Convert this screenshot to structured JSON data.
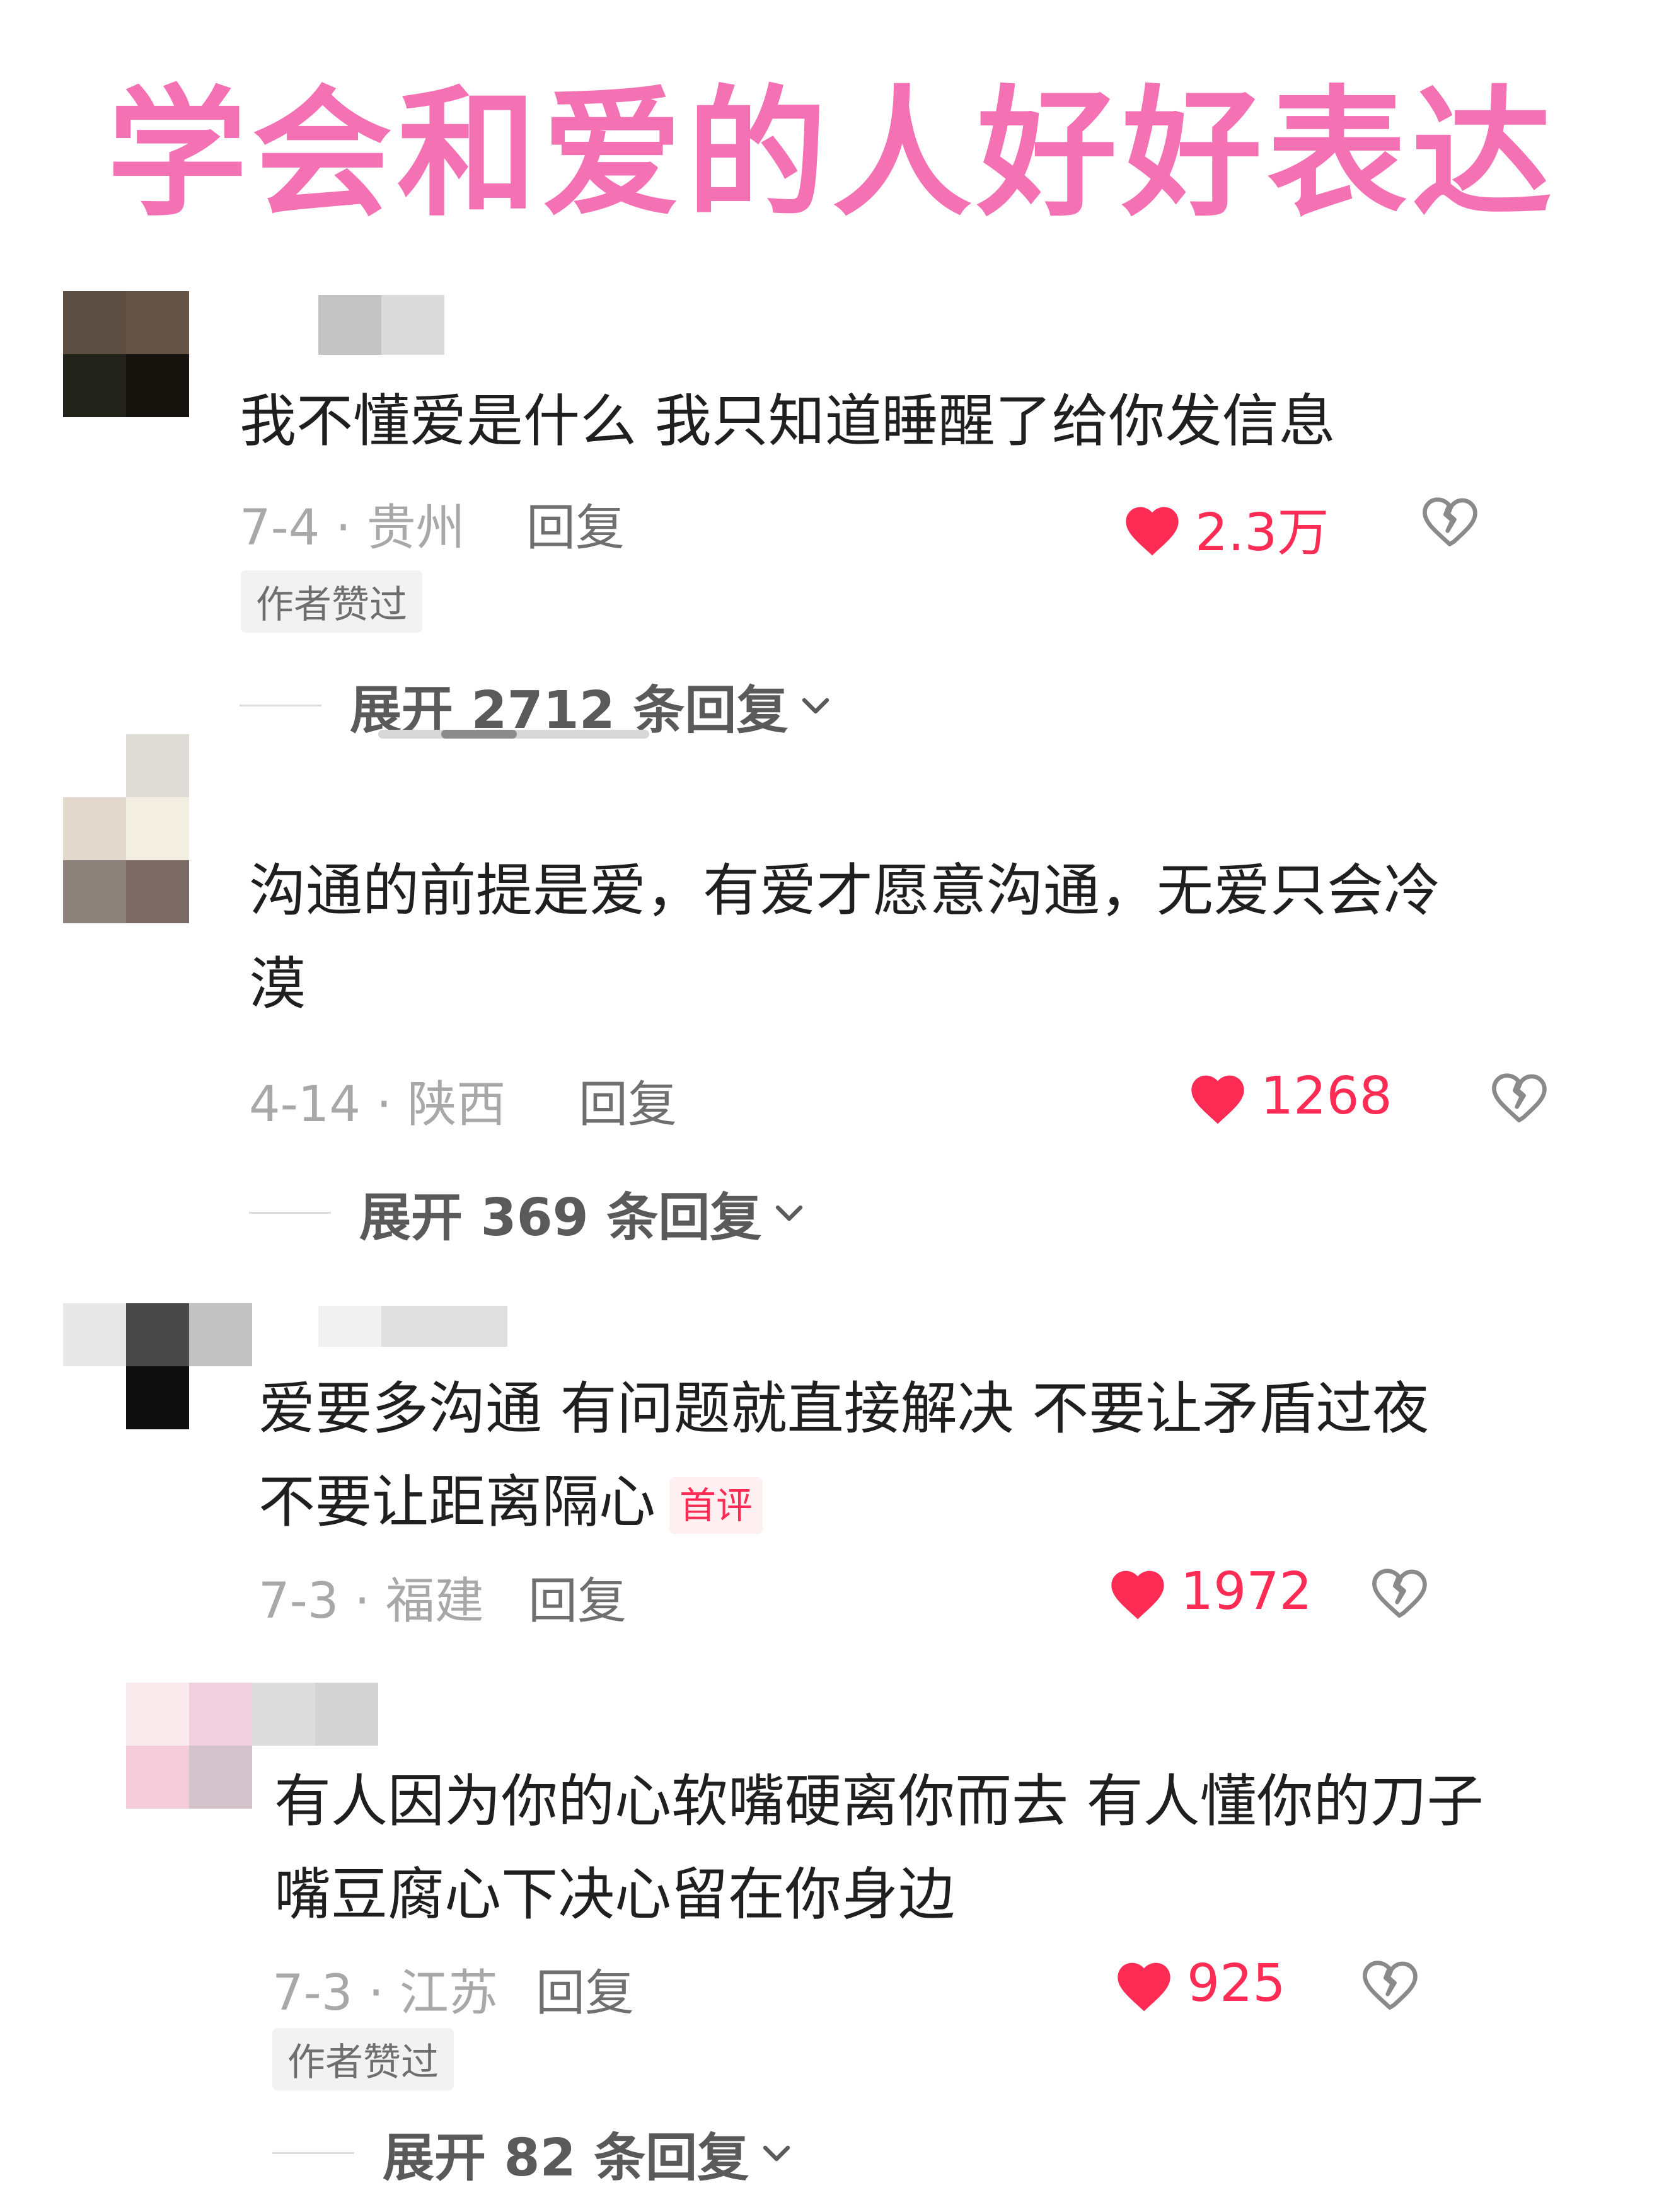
{
  "page": {
    "title": "学会和爱的人好好表达"
  },
  "comments": [
    {
      "text_lines": [
        "我不懂爱是什么 我只知道睡醒了给你发信息"
      ],
      "date_location": "7-4 · 贵州",
      "reply_label": "回复",
      "likes": "2.3万",
      "badge": "作者赞过",
      "expand_label": "展开 2712 条回复"
    },
    {
      "text_lines": [
        "沟通的前提是爱，有爱才愿意沟通，无爱只会冷",
        "漠"
      ],
      "date_location": "4-14 · 陕西",
      "reply_label": "回复",
      "likes": "1268",
      "expand_label": "展开 369 条回复"
    },
    {
      "text_lines": [
        "爱要多沟通 有问题就直接解决 不要让矛盾过夜",
        "不要让距离隔心"
      ],
      "tag": "首评",
      "date_location": "7-3 · 福建",
      "reply_label": "回复",
      "likes": "1972"
    },
    {
      "text_lines": [
        "有人因为你的心软嘴硬离你而去 有人懂你的刀子",
        "嘴豆腐心下决心留在你身边"
      ],
      "date_location": "7-3 · 江苏",
      "reply_label": "回复",
      "likes": "925",
      "badge": "作者赞过",
      "expand_label": "展开 82 条回复"
    }
  ],
  "icons": {
    "like": "heart-icon",
    "dislike": "broken-heart-icon",
    "expand": "chevron-down-icon"
  },
  "colors": {
    "title": "#f472b4",
    "like": "#fe2c55",
    "text": "#1f1f1f",
    "meta": "#a8a8a8"
  }
}
